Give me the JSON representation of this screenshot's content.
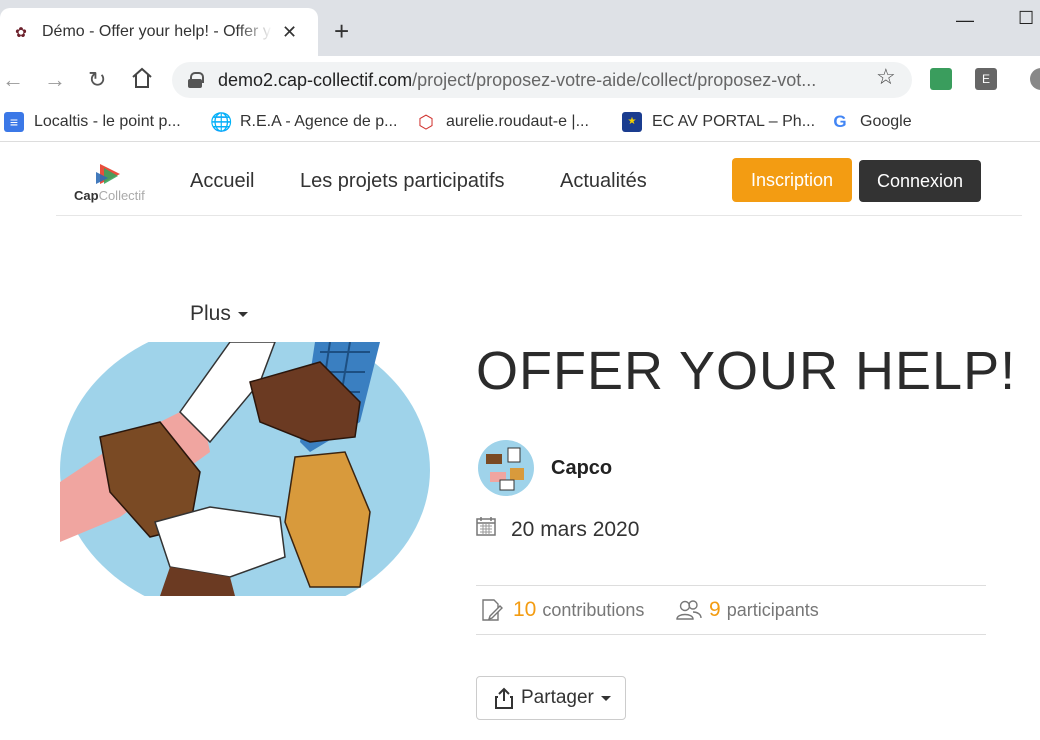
{
  "browser": {
    "tab_title": "Démo - Offer your help! - Offer y",
    "tab_close": "✕",
    "new_tab": "+",
    "url_host": "demo2.cap-collectif.com",
    "url_path": "/project/proposez-votre-aide/collect/proposez-vot...",
    "bookmarks": [
      {
        "label": "Localtis - le point p...",
        "icon": "doc-icon",
        "color": "#3b78e7"
      },
      {
        "label": "R.E.A - Agence de p...",
        "icon": "globe-icon",
        "color": "#444444"
      },
      {
        "label": "aurelie.roudaut-e |...",
        "icon": "hexagon-icon",
        "color": "#d0312d"
      },
      {
        "label": "EC AV PORTAL – Ph...",
        "icon": "eu-flag-icon",
        "color": "#1a3c8f"
      },
      {
        "label": "Google",
        "icon": "google-icon",
        "color": "#4285f4"
      }
    ]
  },
  "site": {
    "logo_bold": "Cap",
    "logo_light": "Collectif",
    "nav": [
      "Accueil",
      "Les projets participatifs",
      "Actualités"
    ],
    "signup_label": "Inscription",
    "login_label": "Connexion",
    "accent_color": "#f39c12"
  },
  "project": {
    "more_label": "Plus",
    "title": "OFFER YOUR HELP!",
    "author": "Capco",
    "date": "20 mars 2020",
    "contributions_count": "10",
    "contributions_label": "contributions",
    "participants_count": "9",
    "participants_label": "participants",
    "share_label": "Partager"
  }
}
